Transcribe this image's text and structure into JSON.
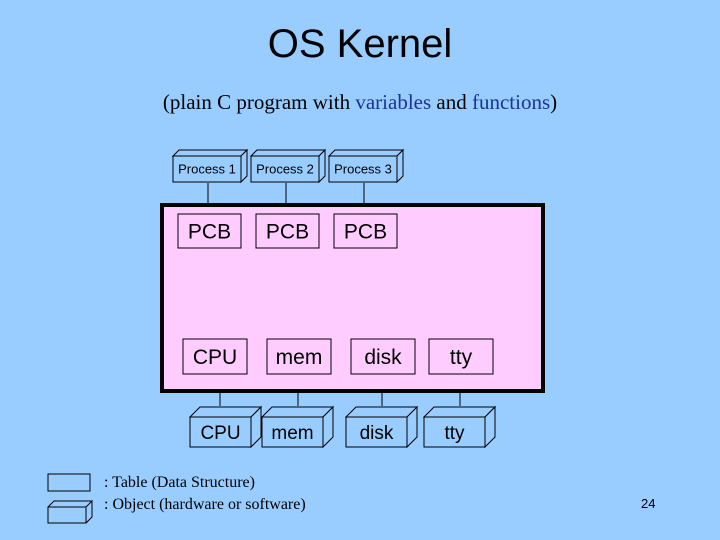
{
  "title": "OS Kernel",
  "subtitle": {
    "prefix": "(plain C program with ",
    "variables": "variables",
    "middle": " and ",
    "functions": "functions",
    "suffix": ")"
  },
  "processes": [
    "Process 1",
    "Process 2",
    "Process 3"
  ],
  "kernel": {
    "pcbs": [
      "PCB",
      "PCB",
      "PCB"
    ],
    "resource_tables": [
      "CPU",
      "mem",
      "disk",
      "tty"
    ]
  },
  "hardware_objects": [
    "CPU",
    "mem",
    "disk",
    "tty"
  ],
  "legend": {
    "table": ":  Table  (Data Structure)",
    "object": ":  Object (hardware or software)"
  },
  "page_number": "24",
  "colors": {
    "background": "#99ccff",
    "kernel_fill": "#ffccff",
    "highlight_text": "#1a3399"
  }
}
